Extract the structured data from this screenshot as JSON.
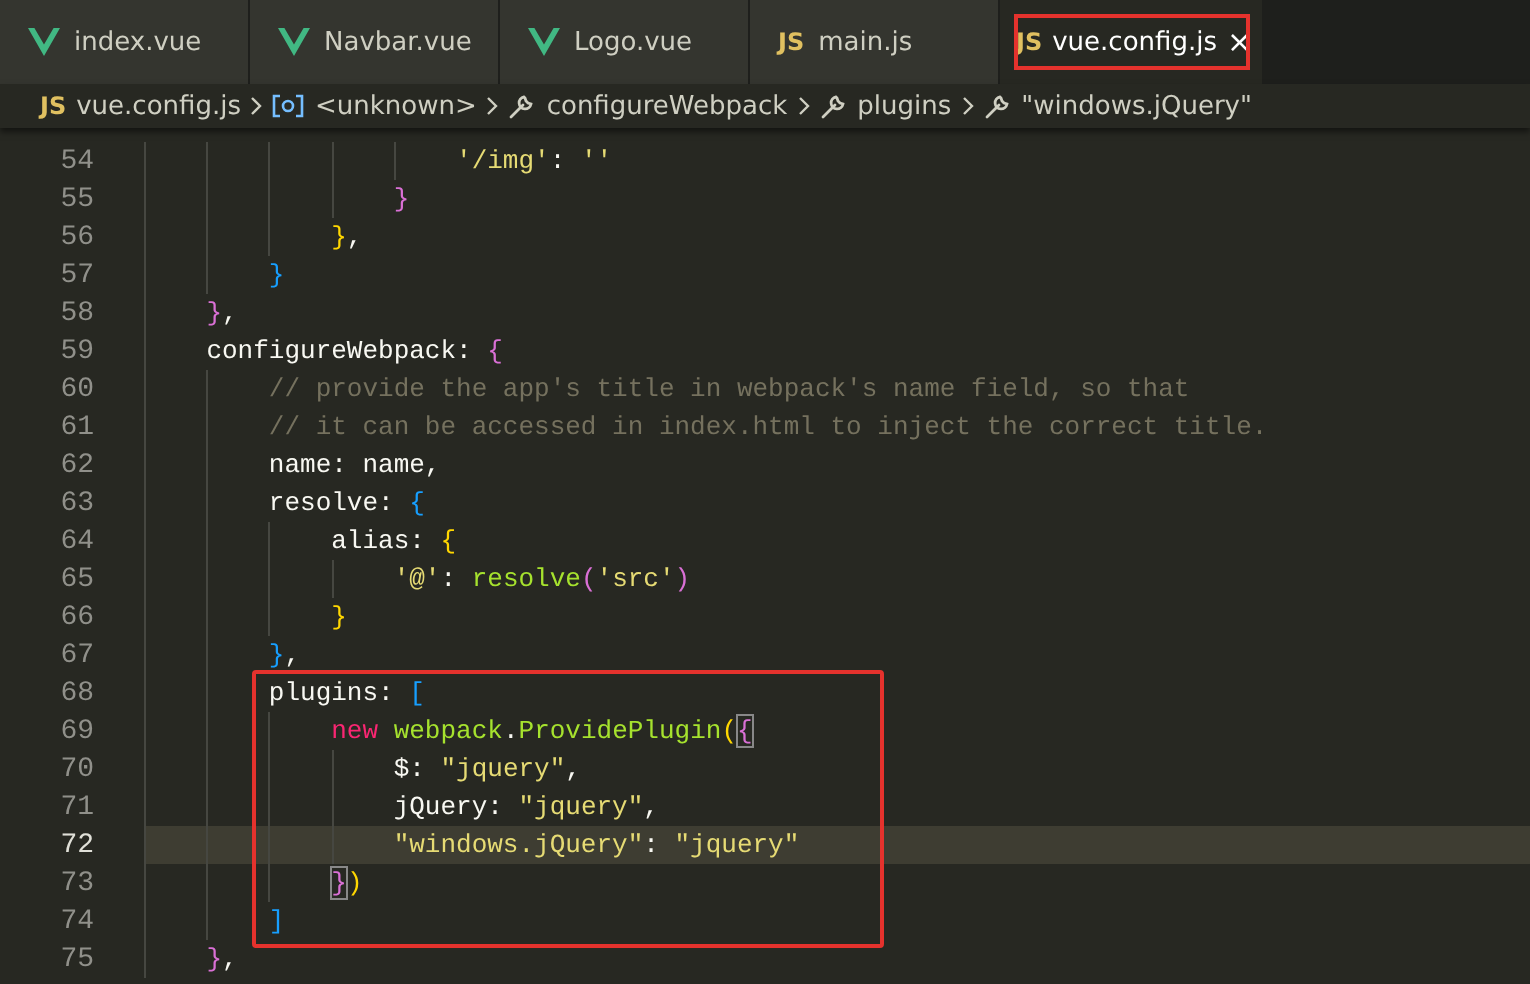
{
  "tabs": [
    {
      "label": "index.vue",
      "kind": "vue",
      "selected": false,
      "highlighted": false
    },
    {
      "label": "Navbar.vue",
      "kind": "vue",
      "selected": false,
      "highlighted": false
    },
    {
      "label": "Logo.vue",
      "kind": "vue",
      "selected": false,
      "highlighted": false
    },
    {
      "label": "main.js",
      "kind": "js",
      "badge": "JS",
      "selected": false,
      "highlighted": false
    },
    {
      "label": "vue.config.js",
      "kind": "js",
      "badge": "JS",
      "selected": true,
      "highlighted": true,
      "close": "×"
    }
  ],
  "breadcrumb": [
    {
      "kind": "file",
      "badge": "JS",
      "label": "vue.config.js"
    },
    {
      "kind": "symbol",
      "label": "<unknown>"
    },
    {
      "kind": "property",
      "label": "configureWebpack"
    },
    {
      "kind": "property",
      "label": "plugins"
    },
    {
      "kind": "property",
      "label": "\"windows.jQuery\""
    }
  ],
  "blocks": [
    {
      "boxed": false,
      "lines": [
        {
          "number": "54",
          "current": false,
          "tokens": [
            {
              "kind": "str",
              "text": "                    '/img'"
            },
            {
              "kind": "p",
              "text": ": "
            },
            {
              "kind": "str",
              "text": "''"
            }
          ]
        },
        {
          "number": "55",
          "current": false,
          "tokens": [
            {
              "kind": "b1",
              "text": "                }"
            }
          ]
        },
        {
          "number": "56",
          "current": false,
          "tokens": [
            {
              "kind": "b2",
              "text": "            }"
            },
            {
              "kind": "p",
              "text": ","
            }
          ]
        },
        {
          "number": "57",
          "current": false,
          "tokens": [
            {
              "kind": "b3",
              "text": "        }"
            }
          ]
        },
        {
          "number": "58",
          "current": false,
          "tokens": [
            {
              "kind": "b1",
              "text": "    }"
            },
            {
              "kind": "p",
              "text": ","
            }
          ]
        },
        {
          "number": "59",
          "current": false,
          "tokens": [
            {
              "kind": "p",
              "text": "    configureWebpack: "
            },
            {
              "kind": "b1",
              "text": "{"
            }
          ]
        },
        {
          "number": "60",
          "current": false,
          "tokens": [
            {
              "kind": "c",
              "text": "        // provide the app's title in webpack's name field, so that"
            }
          ]
        },
        {
          "number": "61",
          "current": false,
          "tokens": [
            {
              "kind": "c",
              "text": "        // it can be accessed in index.html to inject the correct title."
            }
          ]
        },
        {
          "number": "62",
          "current": false,
          "tokens": [
            {
              "kind": "p",
              "text": "        name: name,"
            }
          ]
        },
        {
          "number": "63",
          "current": false,
          "tokens": [
            {
              "kind": "p",
              "text": "        resolve: "
            },
            {
              "kind": "b3",
              "text": "{"
            }
          ]
        },
        {
          "number": "64",
          "current": false,
          "tokens": [
            {
              "kind": "p",
              "text": "            alias: "
            },
            {
              "kind": "b2",
              "text": "{"
            }
          ]
        },
        {
          "number": "65",
          "current": false,
          "tokens": [
            {
              "kind": "str",
              "text": "                '@'"
            },
            {
              "kind": "p",
              "text": ": "
            },
            {
              "kind": "fn",
              "text": "resolve"
            },
            {
              "kind": "b1",
              "text": "("
            },
            {
              "kind": "str",
              "text": "'src'"
            },
            {
              "kind": "b1",
              "text": ")"
            }
          ]
        },
        {
          "number": "66",
          "current": false,
          "tokens": [
            {
              "kind": "b2",
              "text": "            }"
            }
          ]
        },
        {
          "number": "67",
          "current": false,
          "tokens": [
            {
              "kind": "b3",
              "text": "        }"
            },
            {
              "kind": "p",
              "text": ","
            }
          ]
        }
      ]
    },
    {
      "boxed": true,
      "lines": [
        {
          "number": "68",
          "current": false,
          "tokens": [
            {
              "kind": "p",
              "text": "        plugins: "
            },
            {
              "kind": "b3",
              "text": "["
            }
          ]
        },
        {
          "number": "69",
          "current": false,
          "tokens": [
            {
              "kind": "kw",
              "text": "            new"
            },
            {
              "kind": "fn",
              "text": " webpack"
            },
            {
              "kind": "p",
              "text": "."
            },
            {
              "kind": "fn",
              "text": "ProvidePlugin"
            },
            {
              "kind": "b2",
              "text": "("
            },
            {
              "kind": "bm",
              "text": "{"
            }
          ]
        },
        {
          "number": "70",
          "current": false,
          "tokens": [
            {
              "kind": "p",
              "text": "                $: "
            },
            {
              "kind": "str",
              "text": "\"jquery\""
            },
            {
              "kind": "p",
              "text": ","
            }
          ]
        },
        {
          "number": "71",
          "current": false,
          "tokens": [
            {
              "kind": "p",
              "text": "                jQuery: "
            },
            {
              "kind": "str",
              "text": "\"jquery\""
            },
            {
              "kind": "p",
              "text": ","
            }
          ]
        },
        {
          "number": "72",
          "current": true,
          "tokens": [
            {
              "kind": "str",
              "text": "                \"windows.jQuery\""
            },
            {
              "kind": "p",
              "text": ": "
            },
            {
              "kind": "str",
              "text": "\"jquery\""
            }
          ]
        },
        {
          "number": "73",
          "current": false,
          "tokens": [
            {
              "kind": "bm",
              "text": "            }"
            },
            {
              "kind": "b2",
              "text": ")"
            }
          ]
        },
        {
          "number": "74",
          "current": false,
          "tokens": [
            {
              "kind": "b3",
              "text": "        ]"
            }
          ]
        }
      ]
    },
    {
      "boxed": false,
      "lines": [
        {
          "number": "75",
          "current": false,
          "tokens": [
            {
              "kind": "b1",
              "text": "    }"
            },
            {
              "kind": "p",
              "text": ","
            }
          ]
        }
      ]
    }
  ]
}
